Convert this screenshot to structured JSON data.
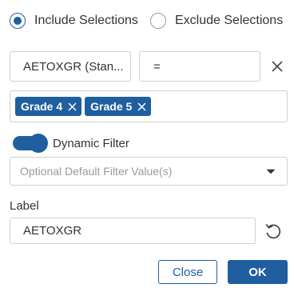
{
  "mode": {
    "include_label": "Include Selections",
    "exclude_label": "Exclude Selections",
    "selected": "include"
  },
  "filter": {
    "field_value": "AETOXGR  (Stan...",
    "operator_value": "=",
    "chips": [
      "Grade 4",
      "Grade 5"
    ]
  },
  "dynamic_filter": {
    "label": "Dynamic Filter",
    "enabled": true
  },
  "default_value": {
    "placeholder": "Optional Default Filter Value(s)"
  },
  "label_section": {
    "title": "Label",
    "value": "AETOXGR"
  },
  "buttons": {
    "close_label": "Close",
    "ok_label": "OK"
  },
  "icons": {
    "remove": "close-icon",
    "chip_remove": "close-icon",
    "dropdown": "caret-down-icon",
    "reset": "undo-icon"
  },
  "colors": {
    "accent": "#1f5fa0",
    "border": "#cfcfcf",
    "text": "#333333",
    "placeholder": "#9a9a9a"
  }
}
